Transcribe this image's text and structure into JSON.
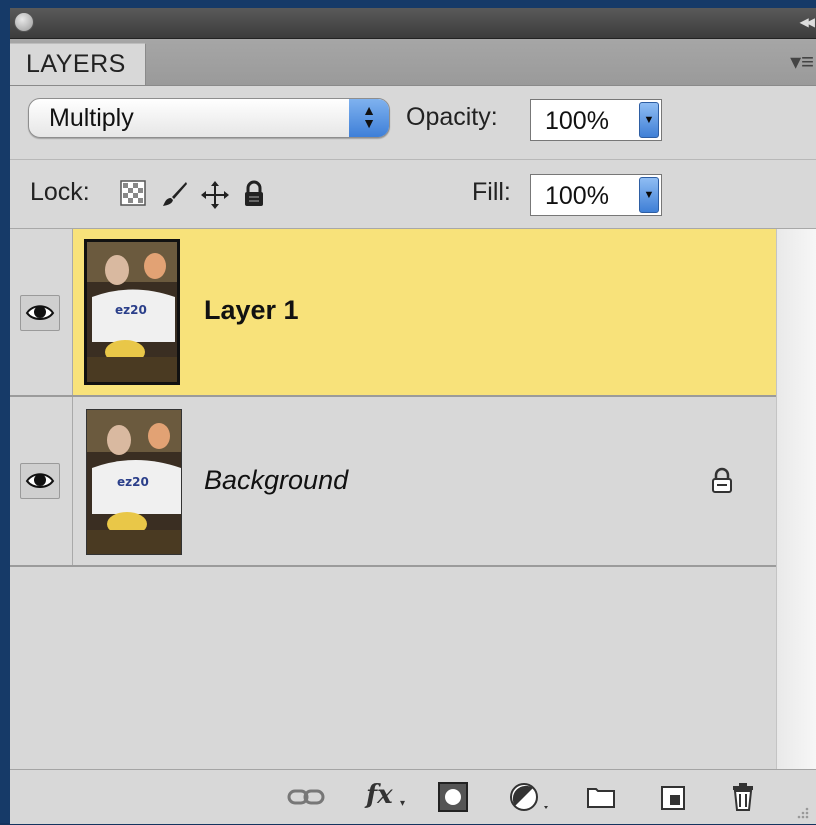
{
  "panel": {
    "tab_label": "LAYERS",
    "menu_icon": "panel-menu-icon"
  },
  "controls": {
    "blend_mode": "Multiply",
    "opacity_label": "Opacity:",
    "opacity_value": "100%",
    "lock_label": "Lock:",
    "fill_label": "Fill:",
    "fill_value": "100%"
  },
  "lock_icons": [
    "lock-transparent-pixels-icon",
    "lock-image-pixels-icon",
    "lock-position-icon",
    "lock-all-icon"
  ],
  "layers": [
    {
      "name": "Layer 1",
      "selected": true,
      "visible": true,
      "locked": false
    },
    {
      "name": "Background",
      "selected": false,
      "visible": true,
      "locked": true
    }
  ],
  "bottom_icons": [
    "link-layers-icon",
    "fx-icon",
    "add-mask-icon",
    "adjustment-layer-icon",
    "new-group-icon",
    "new-layer-icon",
    "delete-layer-icon"
  ],
  "bottom_labels": {
    "fx": "fx"
  },
  "colors": {
    "selected_row": "#f8e27a",
    "panel_bg": "#d8d8d8",
    "frame_bg": "#163a68"
  }
}
